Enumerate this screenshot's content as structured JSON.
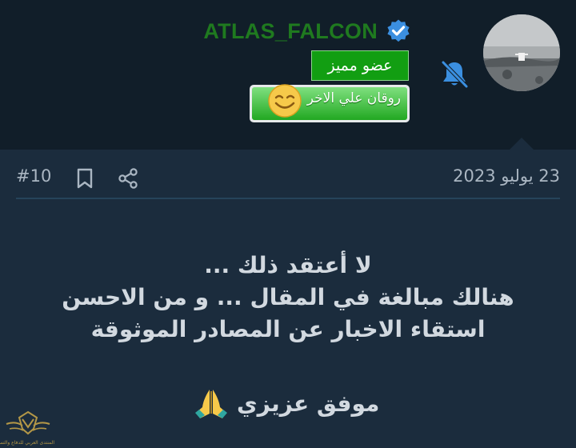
{
  "user": {
    "username": "ATLAS_FALCON",
    "member_badge": "عضو مميز",
    "banner_badge": "روقان علي الاخر"
  },
  "post": {
    "date": "23 يوليو 2023",
    "number": "#10",
    "body_lines": [
      "لا أعتقد ذلك ...",
      "هنالك مبالغة في المقال ... و من الاحسن",
      "استقاء الاخبار عن المصادر الموثوقة"
    ],
    "closing": "موفق عزيزي"
  },
  "watermark": {
    "text": "المنتدى العربي للدفاع والتسليح"
  },
  "icons": {
    "verified": "verified-check-icon",
    "muted_bell": "bell-muted-icon",
    "share": "share-icon",
    "bookmark": "bookmark-icon",
    "pray": "folded-hands-emoji",
    "smiley": "smiley-face-icon"
  },
  "colors": {
    "background": "#1b2c3d",
    "header": "#111e29",
    "username": "#1f7a1f",
    "verified": "#3b8fe0",
    "member_badge": "#129e12",
    "bell": "#3b8fe0"
  }
}
